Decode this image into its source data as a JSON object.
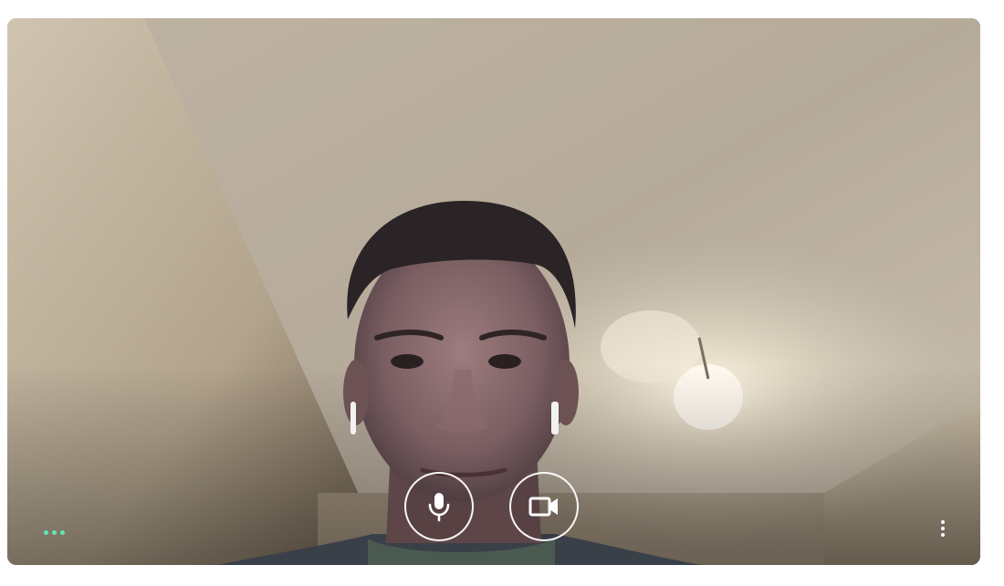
{
  "video_preview": {
    "microphone": {
      "icon": "microphone-icon",
      "state": "on"
    },
    "camera": {
      "icon": "video-camera-icon",
      "state": "on"
    },
    "audio_level_indicator": {
      "icon": "three-dots-icon",
      "color": "#5ee8b4"
    },
    "more_options": {
      "icon": "more-vert-icon"
    }
  }
}
